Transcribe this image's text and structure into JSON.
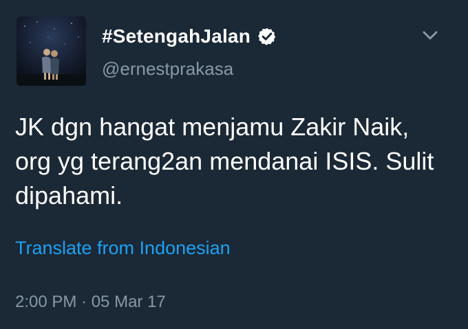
{
  "author": {
    "display_name": "#SetengahJalan",
    "handle": "@ernestprakasa",
    "verified_icon": "verified-badge-icon",
    "avatar_icon": "avatar-photo-night-sky-couple"
  },
  "menu": {
    "icon": "chevron-down-icon"
  },
  "tweet": {
    "text_lines": [
      "JK dgn hangat menjamu Zakir Naik,",
      "org yg terang2an mendanai ISIS. Sulit",
      "dipahami."
    ],
    "translate_label": "Translate from Indonesian",
    "timestamp": "2:00 PM · 05 Mar 17"
  },
  "colors": {
    "background": "#1b2836",
    "text_primary": "#ffffff",
    "text_secondary": "#8899a6",
    "link": "#1da1f2"
  }
}
